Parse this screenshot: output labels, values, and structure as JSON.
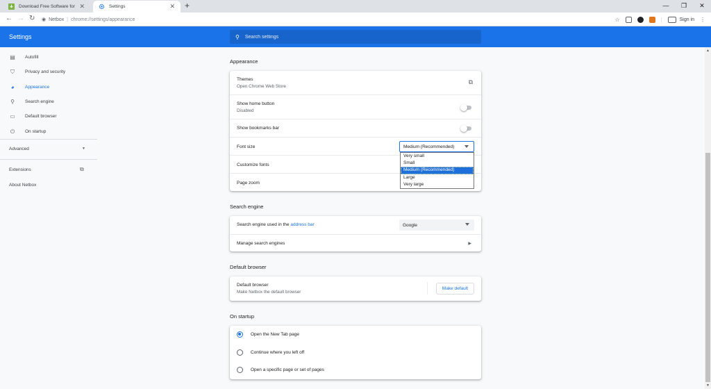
{
  "tabs": [
    {
      "title": "Download Free Software for Win...",
      "favicon": "download-favicon",
      "active": false
    },
    {
      "title": "Settings",
      "favicon": "gear-icon",
      "active": true
    }
  ],
  "toolbar": {
    "site_name": "Netbox",
    "url": "chrome://settings/appearance",
    "sign_in": "Sign in"
  },
  "header": {
    "title": "Settings",
    "search_placeholder": "Search settings"
  },
  "sidebar": {
    "items": [
      {
        "label": "Autofill",
        "icon": "clipboard-icon"
      },
      {
        "label": "Privacy and security",
        "icon": "shield-icon"
      },
      {
        "label": "Appearance",
        "icon": "palette-icon",
        "selected": true
      },
      {
        "label": "Search engine",
        "icon": "search-icon"
      },
      {
        "label": "Default browser",
        "icon": "browser-icon"
      },
      {
        "label": "On startup",
        "icon": "power-icon"
      }
    ],
    "advanced": "Advanced",
    "extensions": "Extensions",
    "about": "About Netbox"
  },
  "appearance": {
    "title": "Appearance",
    "themes_label": "Themes",
    "themes_sub": "Open Chrome Web Store",
    "home_label": "Show home button",
    "home_sub": "Disabled",
    "bookmarks_label": "Show bookmarks bar",
    "font_size_label": "Font size",
    "font_size_value": "Medium (Recommended)",
    "font_size_options": [
      "Very small",
      "Small",
      "Medium (Recommended)",
      "Large",
      "Very large"
    ],
    "customize_fonts": "Customize fonts",
    "page_zoom": "Page zoom"
  },
  "search_engine": {
    "title": "Search engine",
    "used_label_prefix": "Search engine used in the ",
    "used_label_link": "address bar",
    "value": "Google",
    "manage": "Manage search engines"
  },
  "default_browser": {
    "title": "Default browser",
    "label": "Default browser",
    "sub": "Make Netbox the default browser",
    "button": "Make default"
  },
  "on_startup": {
    "title": "On startup",
    "options": [
      "Open the New Tab page",
      "Continue where you left off",
      "Open a specific page or set of pages"
    ],
    "selected_index": 0
  },
  "colors": {
    "accent": "#1a73e8",
    "header_bg": "#1a73e8"
  }
}
